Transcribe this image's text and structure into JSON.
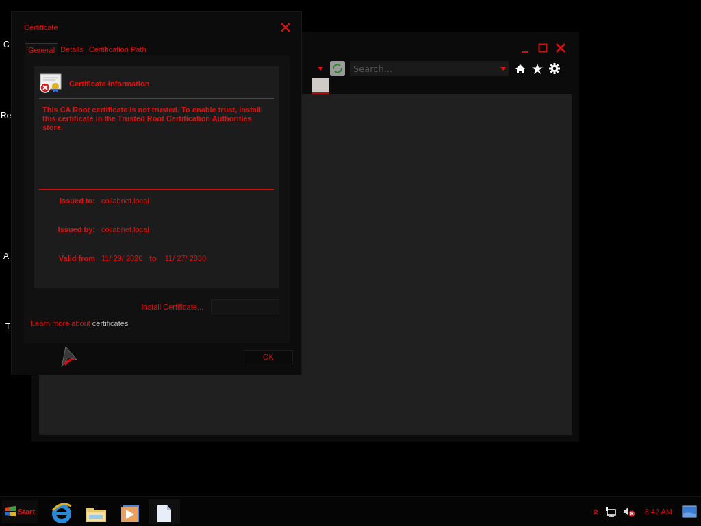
{
  "desktop_icons": [
    {
      "label": "C"
    },
    {
      "label": "Re"
    },
    {
      "label": "A"
    },
    {
      "label": "T"
    }
  ],
  "browser_window": {
    "search": {
      "placeholder": "Search..."
    },
    "tabs": [
      {
        "selected": true
      }
    ]
  },
  "dialog": {
    "title": "Certificate",
    "tabs": [
      {
        "label": "General",
        "selected": true
      },
      {
        "label": "Details",
        "selected": false
      },
      {
        "label": "Certification Path",
        "selected": false
      }
    ],
    "info_title": "Certificate Information",
    "message": "This CA Root certificate is not trusted. To enable trust, install this certificate in the Trusted Root Certification Authorities store.",
    "fields": [
      {
        "kind": "pair",
        "label": "Issued to:",
        "value": "collabnet.local"
      },
      {
        "kind": "pair",
        "label": "Issued by:",
        "value": "collabnet.local"
      },
      {
        "kind": "range",
        "label": "Valid from",
        "from": "11/ 29/ 2020",
        "joiner": "to",
        "to": "11/ 27/ 2030"
      }
    ],
    "buttons": [
      {
        "label": "Install Certificate...",
        "disabled": false
      },
      {
        "disabled": true
      }
    ],
    "learn_more": {
      "text": "Learn more about",
      "link": "certificates"
    },
    "ok": "OK"
  },
  "taskbar": {
    "start": "Start",
    "time": "8:42 AM"
  }
}
